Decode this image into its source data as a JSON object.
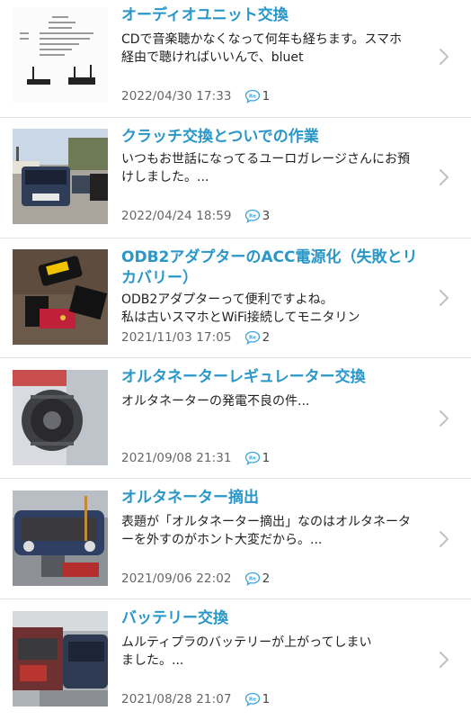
{
  "items": [
    {
      "title": "オーディオユニット交換",
      "excerpt": "CDで音楽聴かなくなって何年も経ちます。スマホ\n経由で聴ければいいんで、bluet",
      "date": "2022/04/30 17:33",
      "comments": "1",
      "thumbnail_icon": "audio-unit-spec-sheet-photo"
    },
    {
      "title": "クラッチ交換とついでの作業",
      "excerpt": "いつもお世話になってるユーロガレージさんにお預\nけしました。...",
      "date": "2022/04/24 18:59",
      "comments": "3",
      "thumbnail_icon": "garage-cars-photo"
    },
    {
      "title": "ODB2アダプターのACC電源化（失敗とリカバリー）",
      "excerpt": "ODB2アダプターって便利ですよね。\n私は古いスマホとWiFi接続してモニタリン",
      "date": "2021/11/03 17:05",
      "comments": "2",
      "thumbnail_icon": "obd2-adapter-photo"
    },
    {
      "title": "オルタネーターレギュレーター交換",
      "excerpt": "オルタネーターの発電不良の件...",
      "date": "2021/09/08 21:31",
      "comments": "1",
      "thumbnail_icon": "alternator-photo"
    },
    {
      "title": "オルタネーター摘出",
      "excerpt": "表題が「オルタネーター摘出」なのはオルタネータ\nーを外すのがホント大変だから。...",
      "date": "2021/09/06 22:02",
      "comments": "2",
      "thumbnail_icon": "engine-bay-repair-photo"
    },
    {
      "title": "バッテリー交換",
      "excerpt": "ムルティプラのバッテリーが上がってしまい\nました。...",
      "date": "2021/08/28 21:07",
      "comments": "1",
      "thumbnail_icon": "battery-jump-photo"
    }
  ],
  "colors": {
    "title": "#2a97c9",
    "comment_icon": "#3aa6d8",
    "divider": "#e3e3e3"
  }
}
